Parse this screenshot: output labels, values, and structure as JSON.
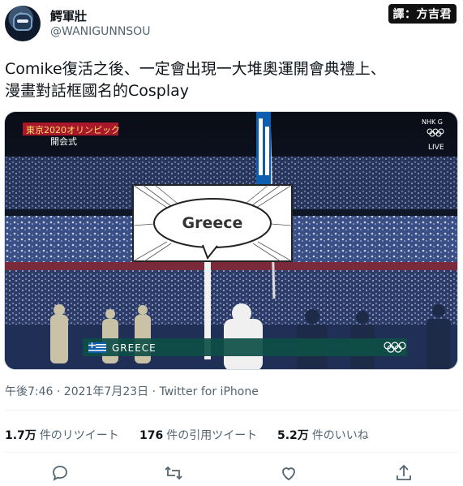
{
  "user": {
    "name": "鰐軍壯",
    "handle": "@WANIGUNNSOU"
  },
  "credit": "譯：方吉君",
  "tweet": {
    "line1": "Comike復活之後、一定會出現一大堆奧運開會典禮上、",
    "line2": "漫畫對話框國名的Cosplay"
  },
  "media": {
    "broadcast_title": "東京2020オリンピック",
    "broadcast_sub": "開会式",
    "channel": "NHK G",
    "live": "LIVE",
    "sign_text": "Greece",
    "country_caption": "GREECE"
  },
  "meta": {
    "timestamp": "午後7:46 · 2021年7月23日 · Twitter for iPhone"
  },
  "stats": [
    {
      "count": "1.7万",
      "label": "件のリツイート"
    },
    {
      "count": "176",
      "label": "件の引用ツイート"
    },
    {
      "count": "5.2万",
      "label": "件のいいね"
    }
  ],
  "actions": [
    "reply-icon",
    "retweet-icon",
    "like-icon",
    "share-icon"
  ]
}
